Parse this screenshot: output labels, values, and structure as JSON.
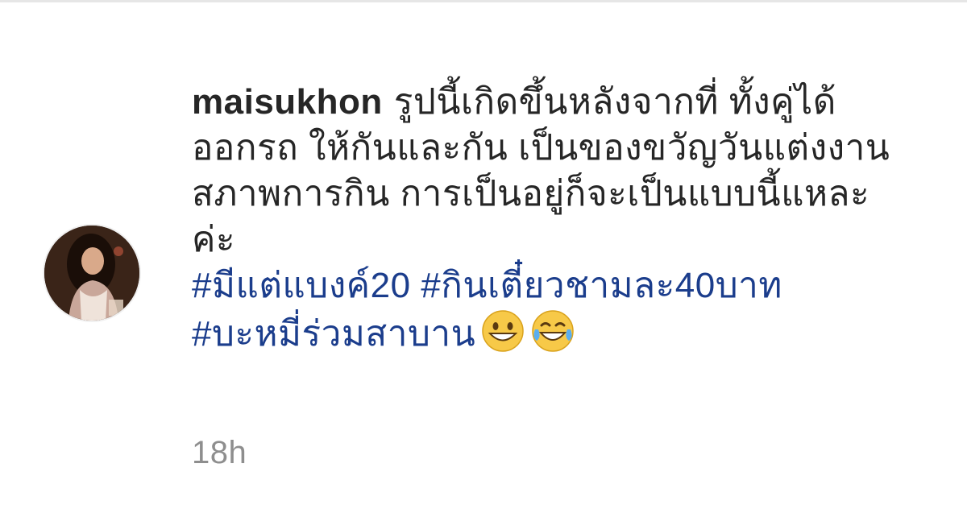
{
  "comment": {
    "username": "maisukhon",
    "text_lines": [
      "รูปนี้เกิดขึ้นหลังจากที่ ทั้งคู่ได้",
      "ออกรถ ให้กันและกัน เป็นของขวัญวันแต่งงาน",
      "สภาพการกิน การเป็นอยู่ก็จะเป็นแบบนี้แหละ",
      "ค่ะ"
    ],
    "hashtags": [
      "#มีแต่แบงค์20",
      "#กินเตี๋ยวชามละ40บาท",
      "#บะหมี่ร่วมสาบาน"
    ],
    "emojis": [
      "grinning-face-emoji",
      "tears-of-joy-emoji"
    ],
    "timestamp": "18h"
  },
  "colors": {
    "text": "#262626",
    "hashtag": "#1b3d8c",
    "timestamp": "#8e8e8e"
  }
}
